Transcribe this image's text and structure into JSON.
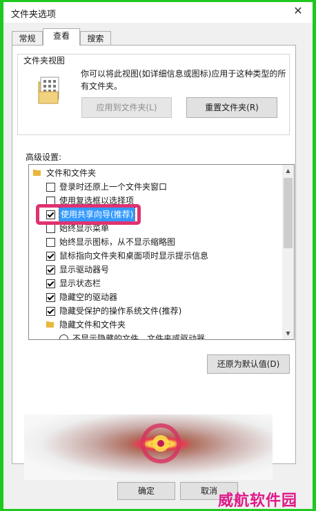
{
  "window": {
    "title": "文件夹选项",
    "close_glyph": "✕"
  },
  "tabs": [
    {
      "label": "常规",
      "active": false
    },
    {
      "label": "查看",
      "active": true
    },
    {
      "label": "搜索",
      "active": false
    }
  ],
  "folder_views": {
    "legend": "文件夹视图",
    "description": "你可以将此视图(如详细信息或图标)应用于这种类型的所有文件夹。",
    "apply_button": "应用到文件夹(L)",
    "reset_button": "重置文件夹(R)"
  },
  "advanced": {
    "label": "高级设置:",
    "items": [
      {
        "type": "folder",
        "text": "文件和文件夹",
        "indent": 0
      },
      {
        "type": "checkbox",
        "text": "登录时还原上一个文件夹窗口",
        "checked": false,
        "indent": 1
      },
      {
        "type": "checkbox",
        "text": "使用复选框以选择项",
        "checked": false,
        "indent": 1
      },
      {
        "type": "checkbox",
        "text": "使用共享向导(推荐)",
        "checked": true,
        "indent": 1,
        "selected": true
      },
      {
        "type": "checkbox",
        "text": "始终显示菜单",
        "checked": false,
        "indent": 1
      },
      {
        "type": "checkbox",
        "text": "始终显示图标，从不显示缩略图",
        "checked": false,
        "indent": 1
      },
      {
        "type": "checkbox",
        "text": "鼠标指向文件夹和桌面项时显示提示信息",
        "checked": true,
        "indent": 1
      },
      {
        "type": "checkbox",
        "text": "显示驱动器号",
        "checked": true,
        "indent": 1
      },
      {
        "type": "checkbox",
        "text": "显示状态栏",
        "checked": true,
        "indent": 1
      },
      {
        "type": "checkbox",
        "text": "隐藏空的驱动器",
        "checked": true,
        "indent": 1
      },
      {
        "type": "checkbox",
        "text": "隐藏受保护的操作系统文件(推荐)",
        "checked": true,
        "indent": 1
      },
      {
        "type": "folder",
        "text": "隐藏文件和文件夹",
        "indent": 1
      },
      {
        "type": "radio",
        "text": "不显示隐藏的文件、文件夹或驱动器",
        "checked": false,
        "indent": 2
      }
    ],
    "restore_button": "还原为默认值(D)"
  },
  "footer": {
    "ok_button": "确定",
    "cancel_button": "取消"
  },
  "watermark": "威航软件园",
  "colors": {
    "highlight_border": "#e03270",
    "selection": "#3399ff",
    "watermark": "#e0198a",
    "frame": "#1fc81f"
  }
}
